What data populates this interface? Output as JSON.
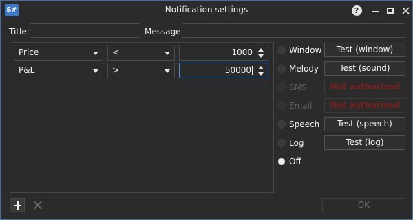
{
  "window": {
    "app_icon_text": "S#",
    "title": "Notification settings",
    "help_label": "?"
  },
  "fields": {
    "title_label": "Title:",
    "title_value": "",
    "message_label": "Message:",
    "message_value": ""
  },
  "conditions": [
    {
      "field": "Price",
      "operator": "<",
      "value": "1000"
    },
    {
      "field": "P&L",
      "operator": ">",
      "value": "50000"
    }
  ],
  "channels": [
    {
      "name": "Window",
      "button": "Test (window)",
      "enabled": true,
      "checked": false
    },
    {
      "name": "Melody",
      "button": "Test (sound)",
      "enabled": true,
      "checked": false
    },
    {
      "name": "SMS",
      "button": "Not authorized",
      "enabled": false,
      "checked": false
    },
    {
      "name": "Email",
      "button": "Not authorized",
      "enabled": false,
      "checked": false
    },
    {
      "name": "Speech",
      "button": "Test (speech)",
      "enabled": true,
      "checked": false
    },
    {
      "name": "Log",
      "button": "Test (log)",
      "enabled": true,
      "checked": false
    },
    {
      "name": "Off",
      "button": "",
      "enabled": true,
      "checked": true
    }
  ],
  "footer": {
    "ok_label": "OK"
  },
  "colors": {
    "background": "#2b2b2b",
    "accent": "#3d8ee0",
    "not_authorized": "#7a2020"
  }
}
